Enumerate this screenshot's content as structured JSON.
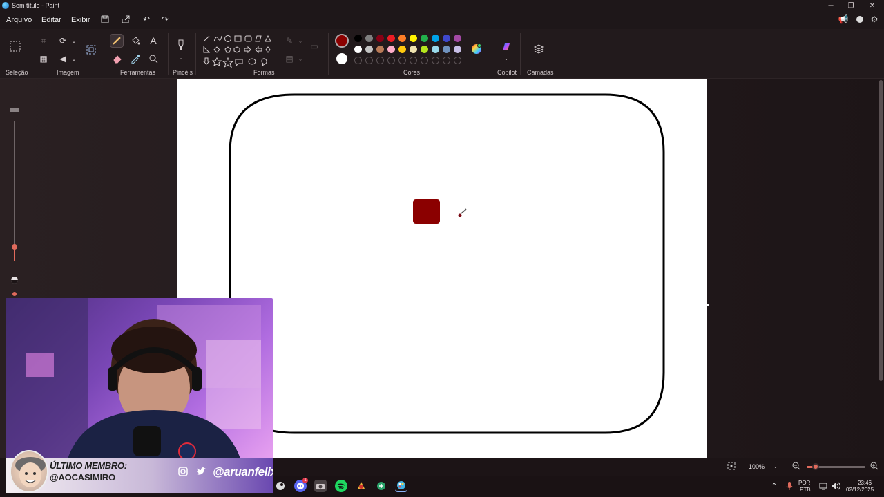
{
  "window": {
    "title": "Sem título - Paint"
  },
  "menu": {
    "file": "Arquivo",
    "edit": "Editar",
    "view": "Exibir"
  },
  "ribbon": {
    "groups": {
      "selection": "Seleção",
      "image": "Imagem",
      "tools": "Ferramentas",
      "brushes": "Pincéis",
      "shapes": "Formas",
      "colors": "Cores",
      "copilot": "Copilot",
      "layers": "Camadas"
    },
    "text_tool_glyph": "A"
  },
  "colors": {
    "primary": "#8b0000",
    "secondary": "#ffffff",
    "palette_row1": [
      "#000000",
      "#7f7f7f",
      "#880015",
      "#ed1c24",
      "#ff7f27",
      "#fff200",
      "#22b14c",
      "#00a2e8",
      "#3f48cc",
      "#a349a4"
    ],
    "palette_row2": [
      "#ffffff",
      "#c3c3c3",
      "#b97a57",
      "#ffaec9",
      "#ffc90e",
      "#efe4b0",
      "#b5e61d",
      "#99d9ea",
      "#7092be",
      "#c8bfe7"
    ]
  },
  "canvas": {
    "background": "#ffffff",
    "shape_stroke": "#000000",
    "fill_square_color": "#8b0000"
  },
  "status": {
    "zoom": "100%",
    "zoom_level_fraction": 0.15
  },
  "overlay": {
    "member_title": "ÚLTIMO MEMBRO:",
    "member_name": "@AOCASIMIRO",
    "streamer_handle": "@aruanfelix"
  },
  "taskbar": {
    "language": "POR",
    "layout": "PTB",
    "time": "23:46",
    "date": "02/12/2025",
    "discord_badge": "1"
  }
}
